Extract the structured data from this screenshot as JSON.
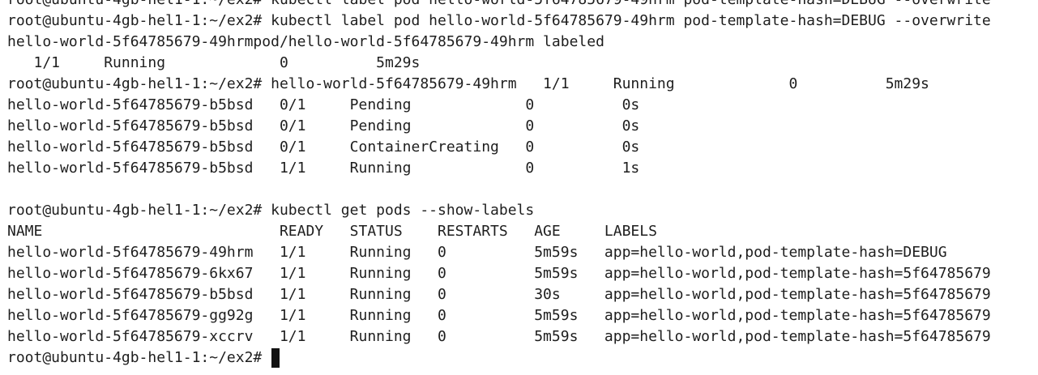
{
  "terminal": {
    "lines": [
      "root@ubuntu-4gb-hel1-1:~/ex2# kubectl label pod hello-world-5f64785679-49hrm pod-template-hash=DEBUG --overwrite",
      "root@ubuntu-4gb-hel1-1:~/ex2# kubectl label pod hello-world-5f64785679-49hrm pod-template-hash=DEBUG --overwrite",
      "hello-world-5f64785679-49hrmpod/hello-world-5f64785679-49hrm labeled",
      "   1/1     Running             0          5m29s",
      "root@ubuntu-4gb-hel1-1:~/ex2# hello-world-5f64785679-49hrm   1/1     Running             0          5m29s",
      "hello-world-5f64785679-b5bsd   0/1     Pending             0          0s",
      "hello-world-5f64785679-b5bsd   0/1     Pending             0          0s",
      "hello-world-5f64785679-b5bsd   0/1     ContainerCreating   0          0s",
      "hello-world-5f64785679-b5bsd   1/1     Running             0          1s",
      "",
      "root@ubuntu-4gb-hel1-1:~/ex2# kubectl get pods --show-labels",
      "NAME                           READY   STATUS    RESTARTS   AGE     LABELS",
      "hello-world-5f64785679-49hrm   1/1     Running   0          5m59s   app=hello-world,pod-template-hash=DEBUG",
      "hello-world-5f64785679-6kx67   1/1     Running   0          5m59s   app=hello-world,pod-template-hash=5f64785679",
      "hello-world-5f64785679-b5bsd   1/1     Running   0          30s     app=hello-world,pod-template-hash=5f64785679",
      "hello-world-5f64785679-gg92g   1/1     Running   0          5m59s   app=hello-world,pod-template-hash=5f64785679",
      "hello-world-5f64785679-xccrv   1/1     Running   0          5m59s   app=hello-world,pod-template-hash=5f64785679"
    ],
    "prompt": "root@ubuntu-4gb-hel1-1:~/ex2# "
  },
  "colors": {
    "background": "#ffffff",
    "text": "#1e1e1e",
    "cursor": "#111111"
  }
}
